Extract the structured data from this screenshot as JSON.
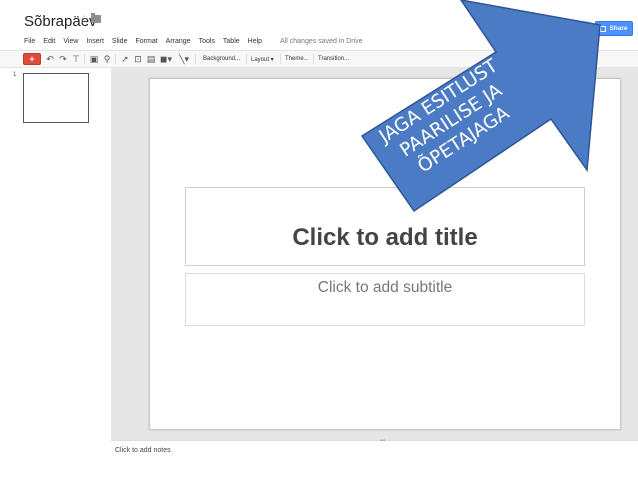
{
  "header": {
    "doc_title": "Sõbrapäev",
    "save_status": "All changes saved in Drive",
    "share_label": "Share"
  },
  "menubar": {
    "items": [
      "File",
      "Edit",
      "View",
      "Insert",
      "Slide",
      "Format",
      "Arrange",
      "Tools",
      "Table",
      "Help"
    ]
  },
  "toolbar": {
    "new_slide_symbol": "+",
    "background_label": "Background...",
    "layout_label": "Layout ▾",
    "theme_label": "Theme...",
    "transition_label": "Transition..."
  },
  "filmstrip": {
    "slide_number": "1"
  },
  "slide": {
    "title_placeholder": "Click to add title",
    "subtitle_placeholder": "Click to add subtitle"
  },
  "notes": {
    "placeholder": "Click to add notes"
  },
  "callout": {
    "lines": [
      "JAGA ESITLUST",
      "PAARILISE JA",
      "ÕPETAJAGA"
    ],
    "fill_color": "#4a7bc4",
    "stroke_color": "#2f5597"
  },
  "colors": {
    "share_button": "#4d90fe",
    "new_slide_button": "#dd4b39",
    "canvas_background": "#e6e6e6"
  },
  "icons": {
    "star": "star-icon",
    "folder": "folder-icon",
    "undo": "undo-icon",
    "redo": "redo-icon",
    "paint_format": "paint-format-icon",
    "zoom": "zoom-icon",
    "select": "select-cursor-icon",
    "text_box": "text-box-icon",
    "image": "image-icon",
    "shape": "shape-icon",
    "line": "line-icon",
    "lock": "lock-icon"
  }
}
